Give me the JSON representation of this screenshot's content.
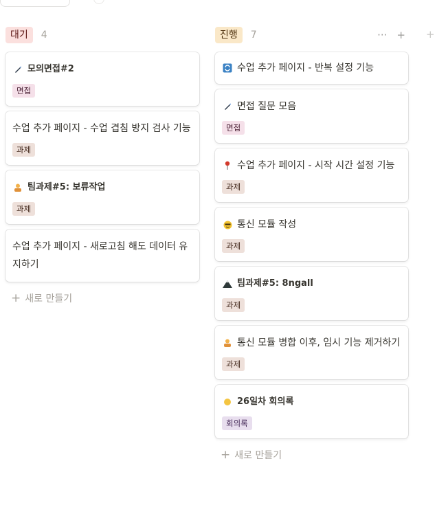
{
  "columns": {
    "todo": {
      "status": "대기",
      "count": "4",
      "cards": [
        {
          "emoji": "pen-icon",
          "title": "모의면접#2",
          "tag": "면접"
        },
        {
          "emoji": "",
          "title": "수업 추가 페이지 - 수업 겹침 방지 검사 기능",
          "tag": "과제"
        },
        {
          "emoji": "person-icon",
          "title": "팀과제#5: 보류작업",
          "tag": "과제"
        },
        {
          "emoji": "",
          "title": "수업 추가 페이지 - 새로고침 해도 데이터 유지하기",
          "tag": ""
        }
      ],
      "new_label": "새로 만들기"
    },
    "progress": {
      "status": "진행",
      "count": "7",
      "actions": {
        "more": "···",
        "add": "+"
      },
      "cards": [
        {
          "emoji": "repeat-icon",
          "title": "수업 추가 페이지 - 반복 설정 기능",
          "tag": ""
        },
        {
          "emoji": "pen-icon",
          "title": "면접 질문 모음",
          "tag": "면접"
        },
        {
          "emoji": "pin-icon",
          "title": "수업 추가 페이지 - 시작 시간 설정 기능",
          "tag": "과제"
        },
        {
          "emoji": "face-icon",
          "title": "통신 모듈 작성",
          "tag": "과제"
        },
        {
          "emoji": "mountain-icon",
          "title": "팀과제#5: 8ngall",
          "tag": "과제"
        },
        {
          "emoji": "person-icon",
          "title": "통신 모듈 병합 이후, 임시 기능 제거하기",
          "tag": "과제"
        },
        {
          "emoji": "hand-icon",
          "title": "26일차 회의록",
          "tag": "회의록"
        }
      ],
      "new_label": "새로 만들기"
    }
  },
  "extra_plus": "+"
}
